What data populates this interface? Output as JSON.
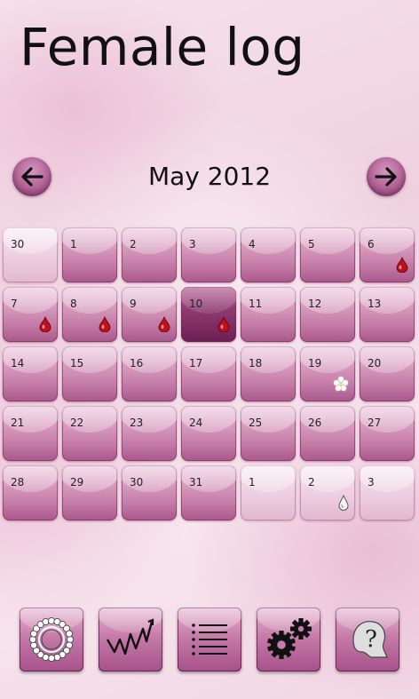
{
  "app": {
    "title": "Female log"
  },
  "calendar": {
    "month_label": "May 2012",
    "weeks": [
      [
        {
          "n": "30",
          "faded": true
        },
        {
          "n": "1"
        },
        {
          "n": "2"
        },
        {
          "n": "3"
        },
        {
          "n": "4"
        },
        {
          "n": "5"
        },
        {
          "n": "6",
          "icon": "blood-drop-icon"
        }
      ],
      [
        {
          "n": "7",
          "icon": "blood-drop-icon"
        },
        {
          "n": "8",
          "icon": "blood-drop-icon"
        },
        {
          "n": "9",
          "icon": "blood-drop-icon"
        },
        {
          "n": "10",
          "today": true,
          "icon": "blood-drop-icon"
        },
        {
          "n": "11"
        },
        {
          "n": "12"
        },
        {
          "n": "13"
        }
      ],
      [
        {
          "n": "14"
        },
        {
          "n": "15"
        },
        {
          "n": "16"
        },
        {
          "n": "17"
        },
        {
          "n": "18"
        },
        {
          "n": "19",
          "icon": "flower-icon"
        },
        {
          "n": "20"
        }
      ],
      [
        {
          "n": "21"
        },
        {
          "n": "22"
        },
        {
          "n": "23"
        },
        {
          "n": "24"
        },
        {
          "n": "25"
        },
        {
          "n": "26"
        },
        {
          "n": "27"
        }
      ],
      [
        {
          "n": "28"
        },
        {
          "n": "29"
        },
        {
          "n": "30"
        },
        {
          "n": "31"
        },
        {
          "n": "1",
          "faded": true
        },
        {
          "n": "2",
          "faded": true,
          "icon": "water-drop-icon"
        },
        {
          "n": "3",
          "faded": true
        }
      ]
    ]
  },
  "toolbar": {
    "buttons": [
      {
        "name": "cycle-ring-button",
        "icon": "cycle-ring-icon"
      },
      {
        "name": "chart-button",
        "icon": "trend-chart-icon"
      },
      {
        "name": "list-button",
        "icon": "list-icon"
      },
      {
        "name": "settings-button",
        "icon": "gears-icon"
      },
      {
        "name": "help-button",
        "icon": "help-question-icon"
      }
    ]
  },
  "colors": {
    "accent": "#8e3c72",
    "cell": "#c37aa6",
    "cell_today": "#6b1f52",
    "blood": "#c0101c"
  }
}
